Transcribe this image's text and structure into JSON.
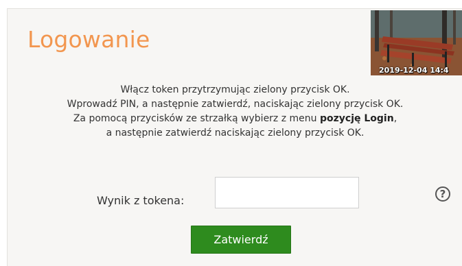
{
  "login": {
    "title": "Logowanie",
    "photo_timestamp": "2019-12-04 14:4",
    "instructions": {
      "line1": "Włącz token przytrzymując zielony przycisk OK.",
      "line2": "Wprowadź PIN, a następnie zatwierdź, naciskając zielony przycisk OK.",
      "line3_pre": "Za pomocą przycisków ze strzałką wybierz z menu ",
      "line3_bold": "pozycję Login",
      "line3_post": ",",
      "line4": "a następnie zatwierdź naciskając zielony przycisk OK."
    },
    "token_label": "Wynik z tokena:",
    "token_value": "",
    "help_glyph": "?",
    "submit_label": "Zatwierdź"
  },
  "colors": {
    "title": "#f2964f",
    "button": "#2e8b1e",
    "panel": "#f7f6f4"
  },
  "icons": {
    "help": "question-circle-icon"
  }
}
